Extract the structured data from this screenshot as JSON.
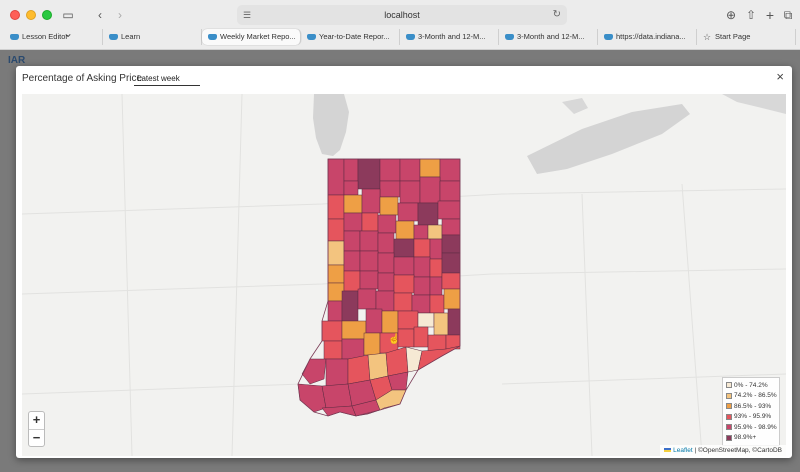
{
  "browser": {
    "address": "localhost",
    "tabs": [
      {
        "label": "Lesson Editor",
        "icon": "cloud-icon",
        "active": false
      },
      {
        "label": "Learn",
        "icon": "cloud-icon",
        "active": false
      },
      {
        "label": "Weekly Market Repo...",
        "icon": "cloud-icon",
        "active": true
      },
      {
        "label": "Year-to-Date Repor...",
        "icon": "cloud-icon",
        "active": false
      },
      {
        "label": "3-Month and 12-M...",
        "icon": "cloud-icon",
        "active": false
      },
      {
        "label": "3-Month and 12-M...",
        "icon": "cloud-icon",
        "active": false
      },
      {
        "label": "https://data.indiana...",
        "icon": "cloud-icon",
        "active": false
      },
      {
        "label": "Start Page",
        "icon": "star-icon",
        "active": false
      }
    ]
  },
  "page": {
    "logo": "IAR"
  },
  "modal": {
    "title": "Percentage of Asking Price",
    "tab": "Latest week",
    "close": "×"
  },
  "map": {
    "zoom_in": "+",
    "zoom_out": "−",
    "legend": [
      {
        "label": "0% - 74.2%",
        "color": "#f6e9d4"
      },
      {
        "label": "74.2% - 86.5%",
        "color": "#f3c47f"
      },
      {
        "label": "86.5% - 93%",
        "color": "#ee9f45"
      },
      {
        "label": "93% - 95.9%",
        "color": "#e5555d"
      },
      {
        "label": "95.9% - 98.9%",
        "color": "#c8456a"
      },
      {
        "label": "98.9%+",
        "color": "#8c3a5c"
      }
    ],
    "attribution": {
      "leaflet": "Leaflet",
      "rest": "| ©OpenStreetMap, ©CartoDB"
    }
  }
}
